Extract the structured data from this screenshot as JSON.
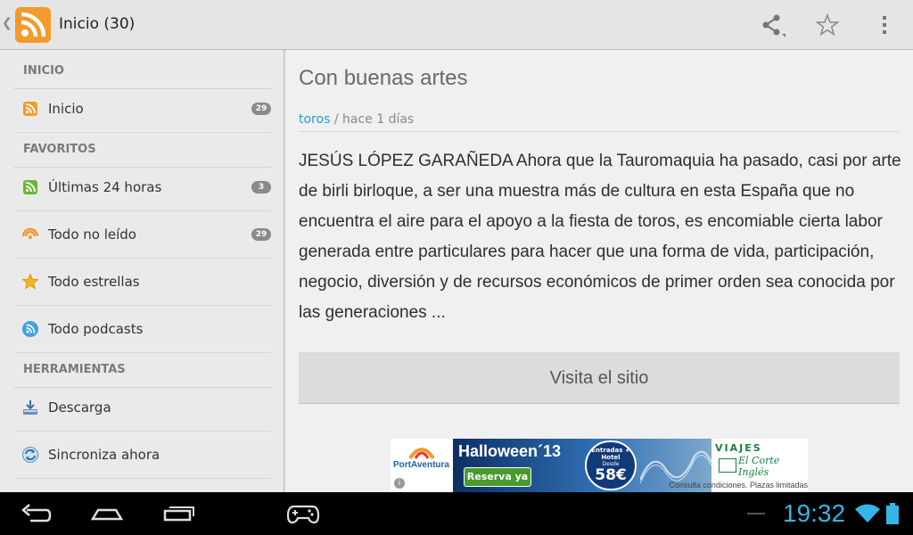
{
  "actionbar": {
    "title": "Inicio (30)",
    "up_icon": "chevron-left-icon",
    "app_icon": "rss-icon",
    "actions": [
      "share-icon",
      "star-outline-icon",
      "overflow-menu-icon"
    ]
  },
  "drawer": {
    "sections": [
      {
        "header": "INICIO",
        "items": [
          {
            "label": "Inicio",
            "icon": "rss-orange-icon",
            "count": "29"
          }
        ]
      },
      {
        "header": "FAVORITOS",
        "items": [
          {
            "label": "Últimas 24 horas",
            "icon": "rss-green-icon",
            "count": "3"
          },
          {
            "label": "Todo no leído",
            "icon": "unread-stack-icon",
            "count": "29"
          },
          {
            "label": "Todo estrellas",
            "icon": "star-icon"
          },
          {
            "label": "Todo podcasts",
            "icon": "podcast-icon"
          }
        ]
      },
      {
        "header": "HERRAMIENTAS",
        "items": [
          {
            "label": "Descarga",
            "icon": "download-icon"
          },
          {
            "label": "Sincroniza ahora",
            "icon": "sync-icon"
          }
        ]
      }
    ]
  },
  "article": {
    "title": "Con buenas artes",
    "tag": "toros",
    "meta_separator": " / ",
    "time": "hace 1 días",
    "body": "JESÚS LÓPEZ GARAÑEDA Ahora que la Tauromaquia ha pasado, casi por arte de birli birloque, a ser una muestra más de cultura en esta España que no encuentra el aire para el apoyo a la fiesta de toros, es encomiable cierta labor generada entre particulares para hacer que una forma de vida, participación, negocio, diversión y de recursos económicos de primer orden sea conocida por las generaciones ...",
    "visit_label": "Visita el sitio"
  },
  "ad": {
    "brand_left": "PortAventura",
    "info_icon": "info-icon",
    "headline": "Halloween´13",
    "cta": "Reserva ya",
    "badge_line1": "Entradas + Hotel",
    "badge_line2": "Desde",
    "badge_price": "58€",
    "brand_right_top": "VIAJES",
    "brand_right_name": "El Corte Inglés",
    "footer": "Consulta condiciones. Plazas limitadas"
  },
  "systembar": {
    "buttons": [
      "back-icon",
      "home-icon",
      "recent-apps-icon",
      "gamepad-icon"
    ],
    "time": "19:32",
    "status_icons": [
      "wifi-icon",
      "battery-icon"
    ]
  },
  "colors": {
    "accent": "#33b5e5",
    "rss_orange": "#f39a2b",
    "tag_link": "#2a9ad4",
    "rss_green": "#6ab82e"
  }
}
